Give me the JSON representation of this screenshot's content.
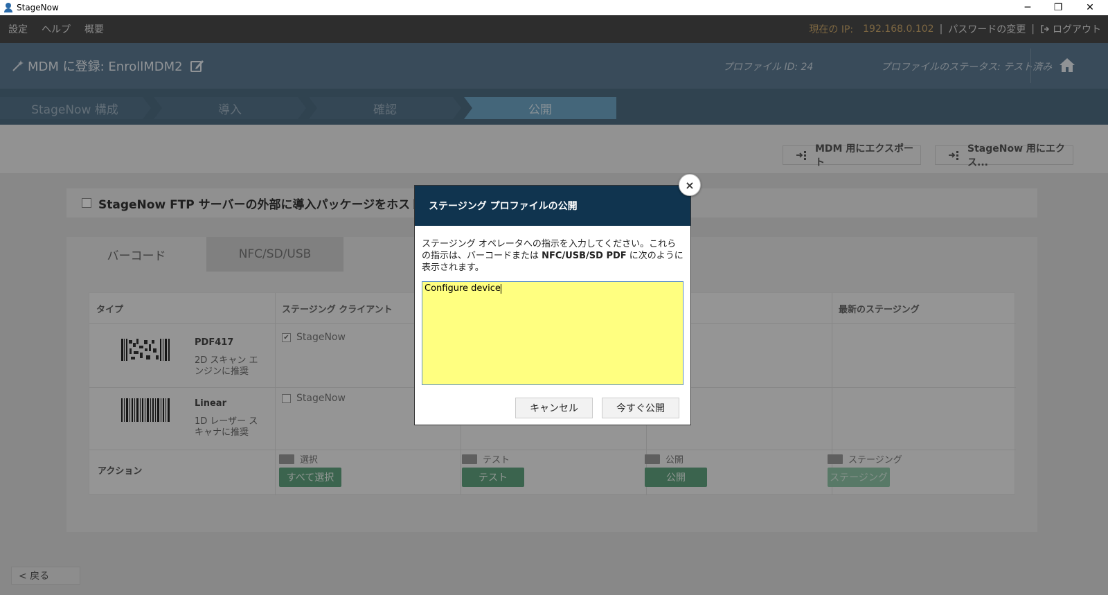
{
  "window": {
    "title": "StageNow",
    "minimize_glyph": "─",
    "restore_glyph": "❐",
    "close_glyph": "✕"
  },
  "menu": {
    "items": [
      "設定",
      "ヘルプ",
      "概要"
    ],
    "ip_label": "現在の IP:",
    "ip_value": "192.168.0.102",
    "separator": "|",
    "change_password": "パスワードの変更",
    "logout": "ログアウト"
  },
  "header": {
    "title": "MDM に登録: EnrollMDM2",
    "profile_id": "プロファイル ID: 24",
    "profile_status": "プロファイルのステータス: テスト済み"
  },
  "wizard": {
    "steps": [
      "StageNow 構成",
      "導入",
      "確認",
      "公開"
    ],
    "active_index": 3
  },
  "toolbar": {
    "export_mdm": "MDM 用にエクスポート",
    "export_stagenow": "StageNow 用にエクス..."
  },
  "ftp": {
    "label": "StageNow FTP サーバーの外部に導入パッケージをホスト",
    "checked": false
  },
  "tabs": [
    "バーコード",
    "NFC/SD/USB"
  ],
  "table": {
    "headers": {
      "type": "タイプ",
      "client": "ステージング クライアント",
      "latest": "最新のステージング"
    },
    "rows": [
      {
        "name": "PDF417",
        "desc": "2D スキャン エンジンに推奨",
        "client": "StageNow",
        "client_checked": true
      },
      {
        "name": "Linear",
        "desc": "1D レーザー スキャナに推奨",
        "client": "StageNow",
        "client_checked": false
      }
    ],
    "action_label": "アクション",
    "actions": [
      {
        "head": "選択",
        "button": "すべて選択",
        "enabled": true
      },
      {
        "head": "テスト",
        "button": "テスト",
        "enabled": true
      },
      {
        "head": "公開",
        "button": "公開",
        "enabled": true
      },
      {
        "head": "ステージング",
        "button": "ステージング",
        "enabled": false
      }
    ]
  },
  "back_button": "<  戻る",
  "modal": {
    "title": "ステージング プロファイルの公開",
    "instructions_1": "ステージング オペレータへの指示を入力してください。これらの指示は、バーコードまたは ",
    "instructions_bold": "NFC/USB/SD PDF",
    "instructions_2": " に次のように表示されます。",
    "textarea_value": "Configure device",
    "cancel": "キャンセル",
    "publish_now": "今すぐ公開",
    "close_glyph": "×"
  },
  "colors": {
    "menubar": "#4a4a4a",
    "header": "#5c7a92",
    "wizard": "#4e6c82",
    "active_step": "#6fa5c5",
    "modal_header": "#10344f",
    "textarea_bg": "#ffff80",
    "action_green": "#5fa27e"
  }
}
